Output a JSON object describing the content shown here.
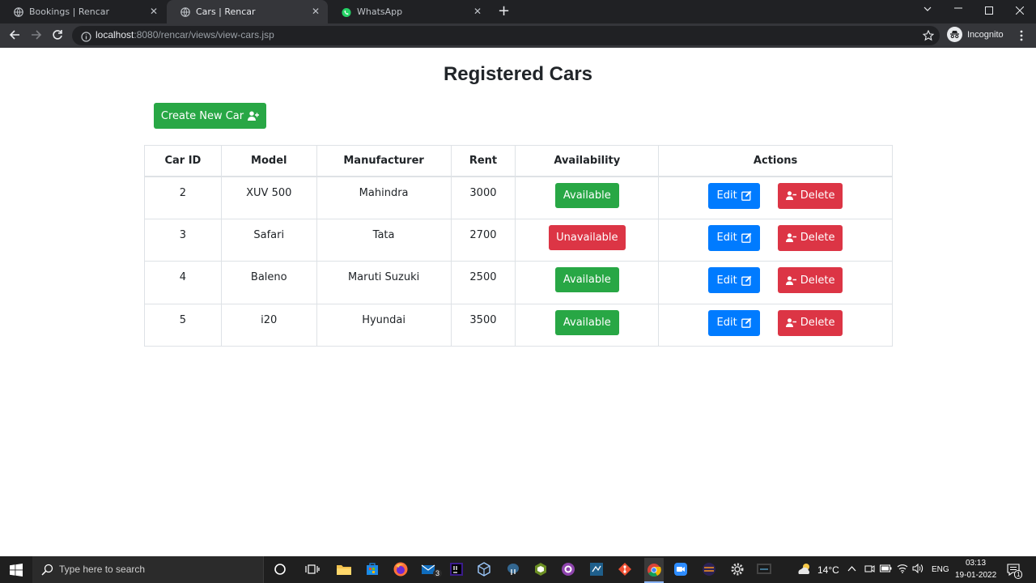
{
  "browser": {
    "tabs": [
      {
        "title": "Bookings | Rencar",
        "active": false
      },
      {
        "title": "Cars | Rencar",
        "active": true
      },
      {
        "title": "WhatsApp",
        "active": false
      }
    ],
    "url_host": "localhost",
    "url_path": ":8080/rencar/views/view-cars.jsp",
    "incognito_label": "Incognito"
  },
  "page": {
    "title": "Registered Cars",
    "create_button": "Create New Car",
    "columns": [
      "Car ID",
      "Model",
      "Manufacturer",
      "Rent",
      "Availability",
      "Actions"
    ],
    "rows": [
      {
        "id": "2",
        "model": "XUV 500",
        "manufacturer": "Mahindra",
        "rent": "3000",
        "availability": "Available",
        "available": true
      },
      {
        "id": "3",
        "model": "Safari",
        "manufacturer": "Tata",
        "rent": "2700",
        "availability": "Unavailable",
        "available": false
      },
      {
        "id": "4",
        "model": "Baleno",
        "manufacturer": "Maruti Suzuki",
        "rent": "2500",
        "availability": "Available",
        "available": true
      },
      {
        "id": "5",
        "model": "i20",
        "manufacturer": "Hyundai",
        "rent": "3500",
        "availability": "Available",
        "available": true
      }
    ],
    "edit_label": "Edit",
    "delete_label": "Delete"
  },
  "taskbar": {
    "search_placeholder": "Type here to search",
    "mail_badge": "3",
    "weather": "14°C",
    "language": "ENG",
    "time": "03:13",
    "date": "19-01-2022",
    "notification_count": "1"
  },
  "colors": {
    "success": "#28a745",
    "danger": "#dc3545",
    "primary": "#007bff"
  }
}
